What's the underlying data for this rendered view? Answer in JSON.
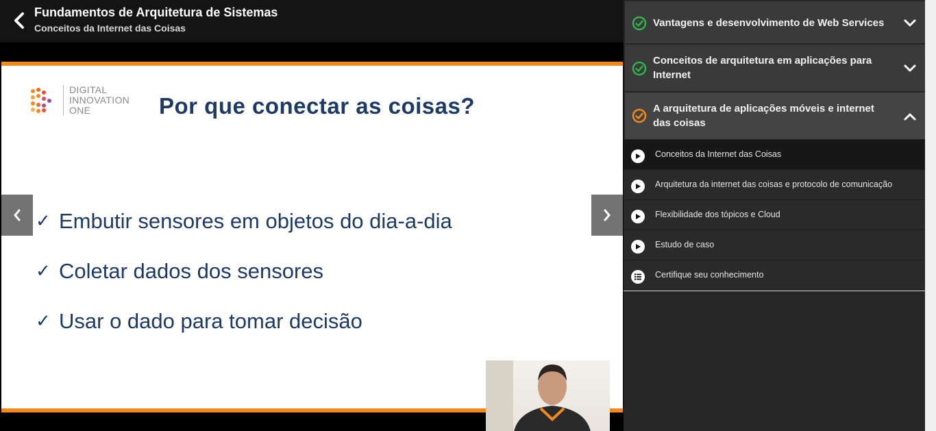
{
  "header": {
    "course_title": "Fundamentos de Arquitetura de Sistemas",
    "lesson_subtitle": "Conceitos da Internet das Coisas"
  },
  "slide": {
    "logo_lines": [
      "DIGITAL",
      "INNOVATION",
      "ONE"
    ],
    "title": "Por que conectar as coisas?",
    "check_glyph": "✓",
    "bullets": [
      "Embutir sensores em objetos do dia-a-dia",
      "Coletar dados dos sensores",
      "Usar o dado para tomar decisão"
    ]
  },
  "sidebar": {
    "modules": [
      {
        "title": "Vantagens e desenvolvimento de Web Services",
        "status": "completed",
        "expanded": false
      },
      {
        "title": "Conceitos de arquitetura em aplicações para Internet",
        "status": "completed",
        "expanded": false
      },
      {
        "title": "A arquitetura de aplicações móveis e internet das coisas",
        "status": "in-progress",
        "expanded": true
      }
    ],
    "lessons": [
      {
        "title": "Conceitos da Internet das Coisas",
        "type": "video",
        "active": true
      },
      {
        "title": "Arquitetura da internet das coisas e protocolo de comunicação",
        "type": "video",
        "active": false
      },
      {
        "title": "Flexibilidade dos tópicos e Cloud",
        "type": "video",
        "active": false
      },
      {
        "title": "Estudo de caso",
        "type": "video",
        "active": false
      },
      {
        "title": "Certifique seu conhecimento",
        "type": "quiz",
        "active": false
      }
    ]
  },
  "colors": {
    "accent_orange": "#f2891f",
    "completed_green": "#2fb34a",
    "slide_text_navy": "#1d3a66"
  },
  "icons": {
    "back": "chevron-left-icon",
    "completed": "check-circle-icon",
    "in_progress": "check-circle-orange-icon",
    "collapsed": "chevron-down-icon",
    "expanded": "chevron-up-icon",
    "video": "play-icon",
    "quiz": "list-icon"
  }
}
